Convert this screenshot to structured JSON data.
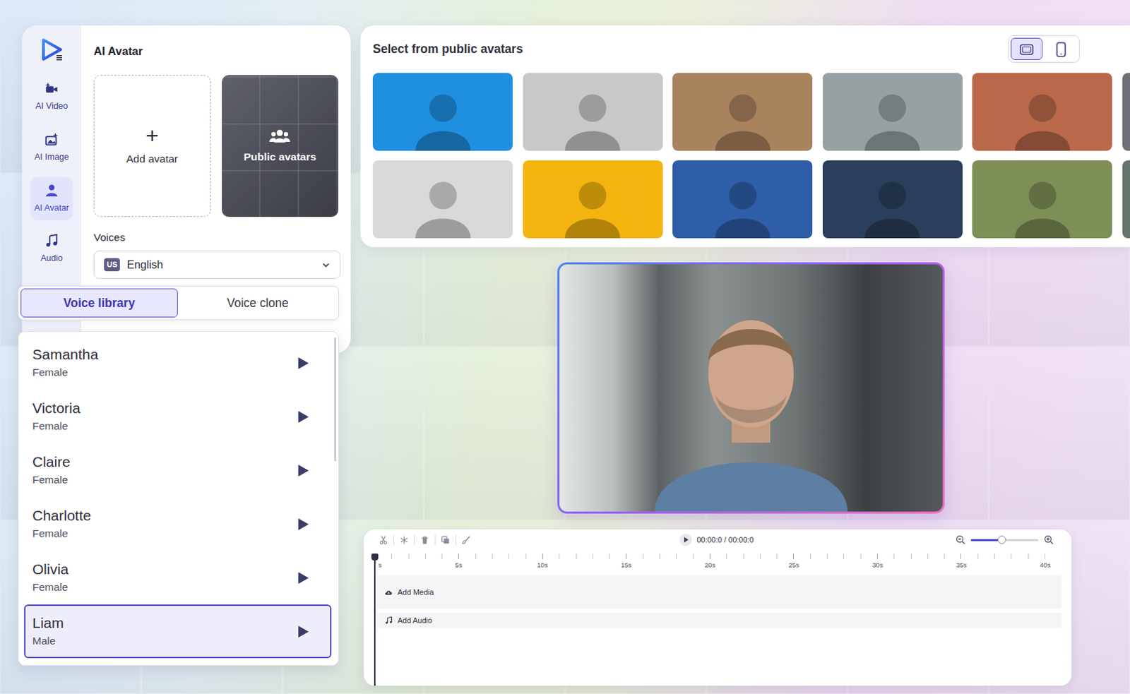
{
  "rail": {
    "items": [
      {
        "label": "AI Video",
        "selected": false
      },
      {
        "label": "AI Image",
        "selected": false
      },
      {
        "label": "AI Avatar",
        "selected": true
      },
      {
        "label": "Audio",
        "selected": false
      }
    ]
  },
  "avatar_panel": {
    "title": "AI Avatar",
    "add_icon": "+",
    "add_label": "Add avatar",
    "public_label": "Public avatars"
  },
  "voices": {
    "label": "Voices",
    "flag": "US",
    "language": "English"
  },
  "voice_tabs": [
    {
      "label": "Voice library",
      "selected": true
    },
    {
      "label": "Voice clone",
      "selected": false
    }
  ],
  "voice_list": [
    {
      "name": "Samantha",
      "gender": "Female",
      "selected": false
    },
    {
      "name": "Victoria",
      "gender": "Female",
      "selected": false
    },
    {
      "name": "Claire",
      "gender": "Female",
      "selected": false
    },
    {
      "name": "Charlotte",
      "gender": "Female",
      "selected": false
    },
    {
      "name": "Olivia",
      "gender": "Female",
      "selected": false
    },
    {
      "name": "Liam",
      "gender": "Male",
      "selected": true
    }
  ],
  "gallery": {
    "title": "Select from public avatars",
    "view_modes": [
      {
        "kind": "landscape",
        "selected": true
      },
      {
        "kind": "portrait",
        "selected": false
      }
    ],
    "avatars": [
      {
        "color": "#1f8fe0"
      },
      {
        "color": "#c8c8cb"
      },
      {
        "color": "#a9825e"
      },
      {
        "color": "#97a1a3"
      },
      {
        "color": "#b9694a"
      },
      {
        "color": "#6f7178"
      },
      {
        "color": "#d9d9dc"
      },
      {
        "color": "#f4b40f"
      },
      {
        "color": "#2e5ea8"
      },
      {
        "color": "#2a3f5c"
      },
      {
        "color": "#7d8f56"
      },
      {
        "color": "#66756c"
      }
    ]
  },
  "timeline": {
    "time": "00:00:0 / 00:00:0",
    "ticks": [
      "s",
      "5s",
      "10s",
      "15s",
      "20s",
      "25s",
      "30s",
      "35s",
      "40s"
    ],
    "zoom": {
      "level": 0.46
    },
    "tracks": [
      {
        "label": "Add Media",
        "kind": "media"
      },
      {
        "label": "Add Audio",
        "kind": "audio"
      }
    ]
  }
}
